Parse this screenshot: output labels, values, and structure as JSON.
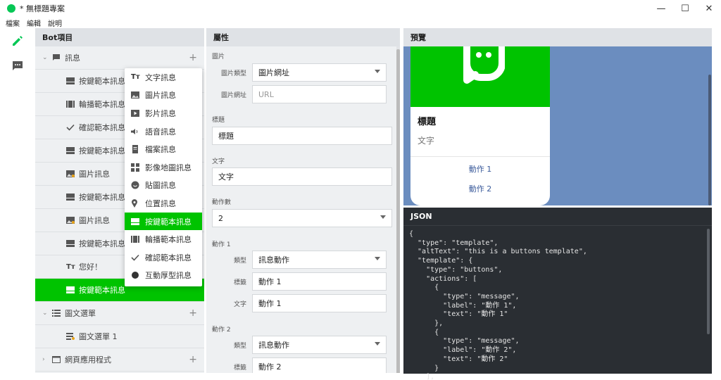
{
  "window": {
    "title": "* 無標題專案",
    "buttons": {
      "minimize": "—",
      "maximize": "☐",
      "close": "✕"
    }
  },
  "menu": [
    "檔案",
    "編輯",
    "說明"
  ],
  "rail": {
    "icons": [
      "pencil-icon",
      "chat-bubble-icon"
    ],
    "accent": "#06c755"
  },
  "left": {
    "header": "Bot項目",
    "groups": [
      {
        "label": "訊息",
        "children": [
          {
            "label": "按鍵範本訊息",
            "icon": "buttons-icon"
          },
          {
            "label": "輪播範本訊息",
            "icon": "carousel-icon"
          },
          {
            "label": "確認範本訊息",
            "icon": "check-icon"
          },
          {
            "label": "按鍵範本訊息",
            "icon": "buttons-icon"
          },
          {
            "label": "圖片訊息",
            "icon": "image-icon"
          },
          {
            "label": "按鍵範本訊息",
            "icon": "buttons-icon"
          },
          {
            "label": "圖片訊息",
            "icon": "image-icon"
          },
          {
            "label": "按鍵範本訊息",
            "icon": "buttons-icon"
          },
          {
            "label": "您好！",
            "icon": "text-icon"
          },
          {
            "label": "按鍵範本訊息",
            "icon": "buttons-icon",
            "selected": true
          }
        ]
      },
      {
        "label": "圖文選單",
        "children": [
          {
            "label": "圖文選單 1",
            "icon": "richmenu-icon"
          }
        ]
      },
      {
        "label": "網頁應用程式",
        "children": []
      }
    ]
  },
  "popup": [
    {
      "label": "文字訊息",
      "icon": "text-icon"
    },
    {
      "label": "圖片訊息",
      "icon": "image-icon"
    },
    {
      "label": "影片訊息",
      "icon": "video-icon"
    },
    {
      "label": "語音訊息",
      "icon": "audio-icon"
    },
    {
      "label": "檔案訊息",
      "icon": "file-icon"
    },
    {
      "label": "影像地圖訊息",
      "icon": "imagemap-icon"
    },
    {
      "label": "貼圖訊息",
      "icon": "sticker-icon"
    },
    {
      "label": "位置訊息",
      "icon": "location-icon"
    },
    {
      "label": "按鍵範本訊息",
      "icon": "buttons-icon",
      "active": true
    },
    {
      "label": "輪播範本訊息",
      "icon": "carousel-icon"
    },
    {
      "label": "確認範本訊息",
      "icon": "check-icon"
    },
    {
      "label": "互動厚型訊息",
      "icon": "flex-icon"
    }
  ],
  "properties": {
    "header": "屬性",
    "image_section": "圖片",
    "image_type_label": "圖片類型",
    "image_type_value": "圖片網址",
    "image_url_label": "圖片網址",
    "image_url_placeholder": "URL",
    "title_section": "標題",
    "title_value": "標題",
    "text_section": "文字",
    "text_value": "文字",
    "action_count_section": "動作數",
    "action_count_value": "2",
    "action1_section": "動作 1",
    "action1_type_label": "類型",
    "action1_type_value": "訊息動作",
    "action1_label_label": "標籤",
    "action1_label_value": "動作 1",
    "action1_text_label": "文字",
    "action1_text_value": "動作 1",
    "action2_section": "動作 2",
    "action2_type_label": "類型",
    "action2_type_value": "訊息動作",
    "action2_label_label": "標籤",
    "action2_label_value": "動作 2"
  },
  "preview": {
    "header": "預覽",
    "card_title": "標題",
    "card_text": "文字",
    "actions": [
      "動作 1",
      "動作 2"
    ],
    "hero_color": "#00c300",
    "background": "#6b8dbf"
  },
  "json_panel": {
    "header": "JSON",
    "code": "{\n  \"type\": \"template\",\n  \"altText\": \"this is a buttons template\",\n  \"template\": {\n    \"type\": \"buttons\",\n    \"actions\": [\n      {\n        \"type\": \"message\",\n        \"label\": \"動作 1\",\n        \"text\": \"動作 1\"\n      },\n      {\n        \"type\": \"message\",\n        \"label\": \"動作 2\",\n        \"text\": \"動作 2\"\n      }\n    ],"
  }
}
